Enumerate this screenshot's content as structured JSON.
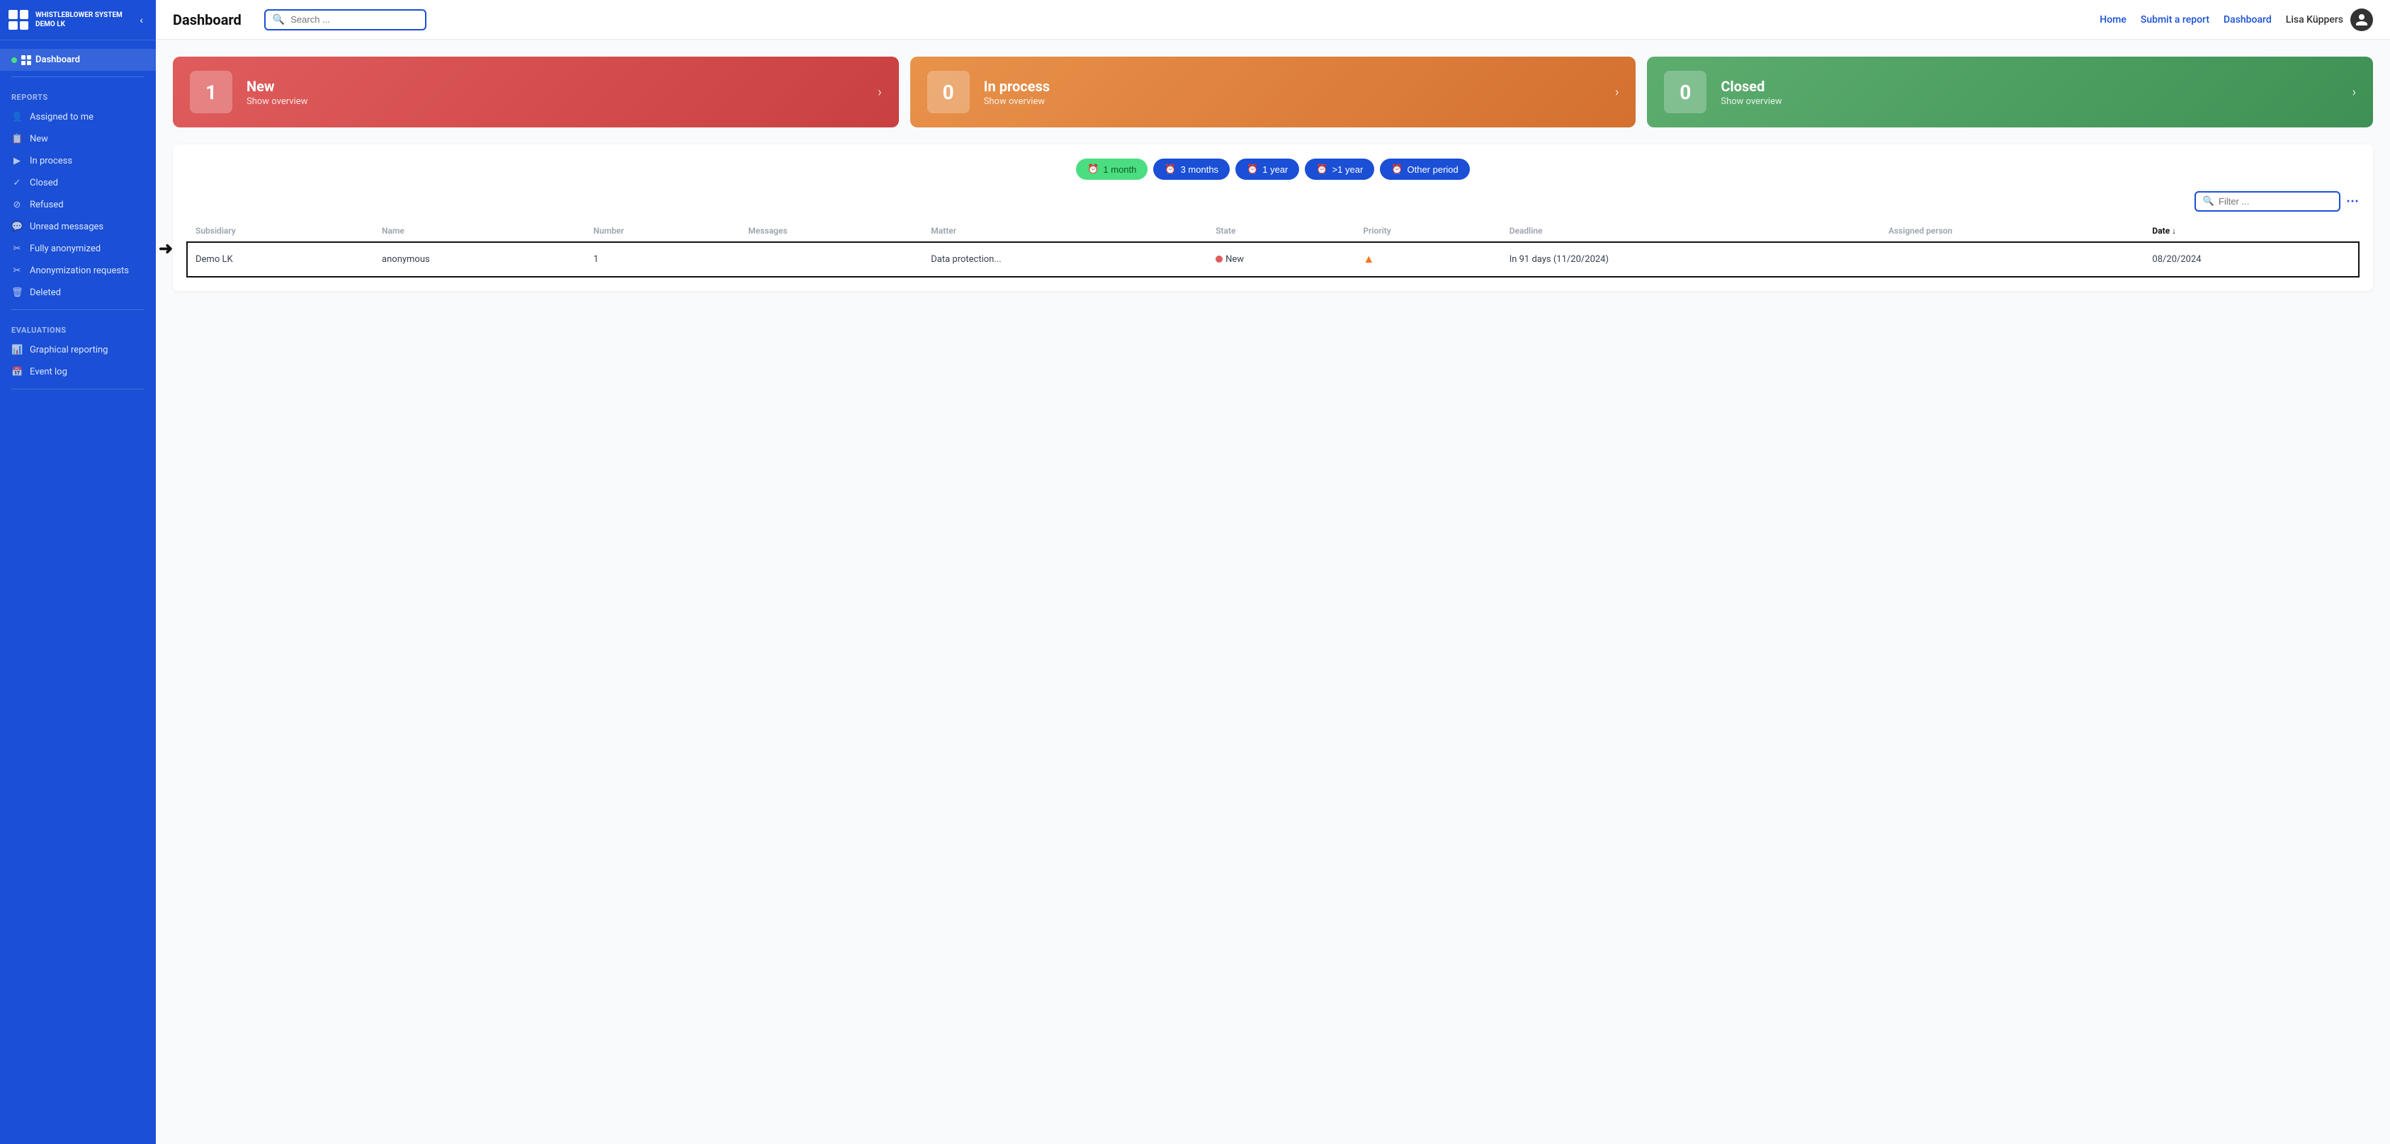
{
  "app": {
    "name": "WHISTLEBLOWER SYSTEM",
    "org": "Demo LK"
  },
  "topnav": {
    "title": "Dashboard",
    "search_placeholder": "Search ...",
    "links": [
      "Home",
      "Submit a report",
      "Dashboard"
    ],
    "user_name": "Lisa Küppers"
  },
  "sidebar": {
    "dashboard_label": "Dashboard",
    "reports_section": "Reports",
    "evaluations_section": "Evaluations",
    "items": [
      {
        "id": "assigned",
        "label": "Assigned to me",
        "icon": "👤"
      },
      {
        "id": "new",
        "label": "New",
        "icon": "📋"
      },
      {
        "id": "in-process",
        "label": "In process",
        "icon": "▶"
      },
      {
        "id": "closed",
        "label": "Closed",
        "icon": "✓"
      },
      {
        "id": "refused",
        "label": "Refused",
        "icon": "⊘"
      },
      {
        "id": "unread",
        "label": "Unread messages",
        "icon": "💬"
      },
      {
        "id": "anonymized",
        "label": "Fully anonymized",
        "icon": "✂"
      },
      {
        "id": "anon-requests",
        "label": "Anonymization requests",
        "icon": "✂"
      },
      {
        "id": "deleted",
        "label": "Deleted",
        "icon": "🗑"
      }
    ],
    "eval_items": [
      {
        "id": "graphical",
        "label": "Graphical reporting",
        "icon": "📊"
      },
      {
        "id": "event-log",
        "label": "Event log",
        "icon": "📅"
      }
    ]
  },
  "status_cards": [
    {
      "id": "new",
      "count": "1",
      "label": "New",
      "sub": "Show overview",
      "color": "red"
    },
    {
      "id": "in-process",
      "count": "0",
      "label": "In process",
      "sub": "Show overview",
      "color": "orange"
    },
    {
      "id": "closed",
      "count": "0",
      "label": "Closed",
      "sub": "Show overview",
      "color": "green"
    }
  ],
  "period_filters": [
    {
      "id": "1month",
      "label": "1 month",
      "active": true
    },
    {
      "id": "3months",
      "label": "3 months",
      "active": false
    },
    {
      "id": "1year",
      "label": "1 year",
      "active": false
    },
    {
      "id": "gt1year",
      "label": ">1 year",
      "active": false
    },
    {
      "id": "other",
      "label": "Other period",
      "active": false
    }
  ],
  "filter": {
    "placeholder": "Filter ..."
  },
  "table": {
    "columns": [
      {
        "id": "subsidiary",
        "label": "Subsidiary"
      },
      {
        "id": "name",
        "label": "Name"
      },
      {
        "id": "number",
        "label": "Number"
      },
      {
        "id": "messages",
        "label": "Messages"
      },
      {
        "id": "matter",
        "label": "Matter"
      },
      {
        "id": "state",
        "label": "State"
      },
      {
        "id": "priority",
        "label": "Priority"
      },
      {
        "id": "deadline",
        "label": "Deadline"
      },
      {
        "id": "assigned",
        "label": "Assigned person"
      },
      {
        "id": "date",
        "label": "Date",
        "sort": "↓"
      }
    ],
    "rows": [
      {
        "subsidiary": "Demo LK",
        "name": "anonymous",
        "number": "1",
        "messages": "",
        "matter": "Data protection...",
        "state": "New",
        "priority": "▲",
        "deadline": "",
        "deadline_text": "In 91 days (11/20/2024)",
        "assigned": "",
        "date": "08/20/2024",
        "highlighted": true
      }
    ]
  }
}
